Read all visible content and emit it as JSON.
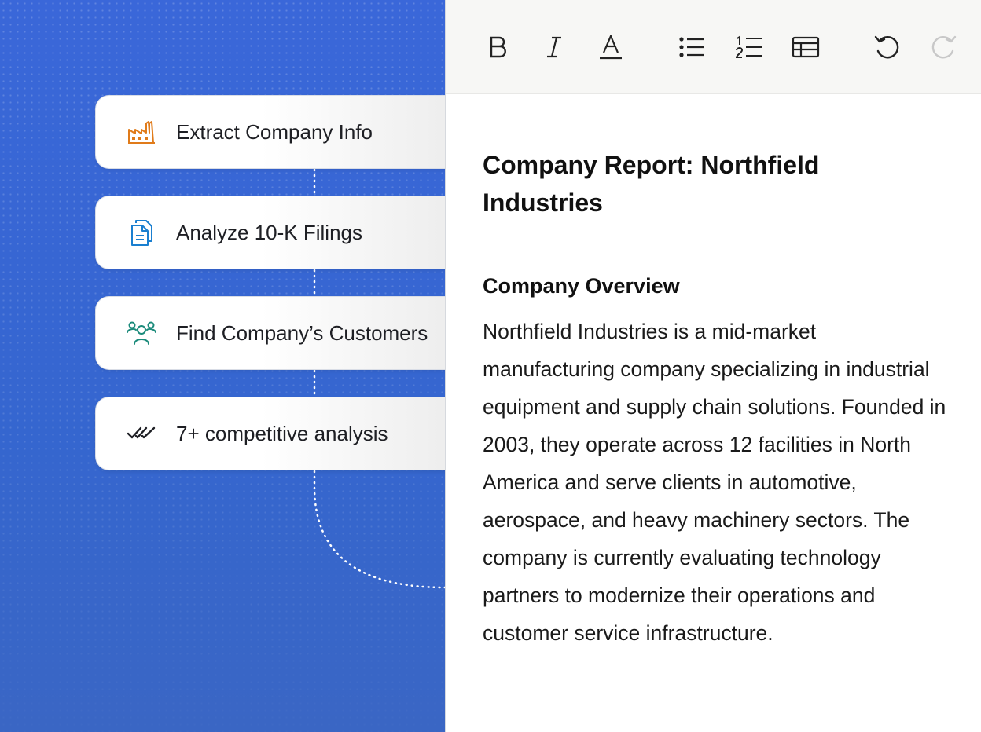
{
  "steps": [
    {
      "label": "Extract Company Info",
      "icon": "factory-icon",
      "color": "#e07b1a"
    },
    {
      "label": "Analyze 10-K Filings",
      "icon": "documents-icon",
      "color": "#1a7fd0"
    },
    {
      "label": "Find Company’s Customers",
      "icon": "people-icon",
      "color": "#1a8a7a"
    },
    {
      "label": "7+ competitive analysis",
      "icon": "double-check-icon",
      "color": "#1e1f24"
    }
  ],
  "toolbar": {
    "buttons": [
      {
        "name": "bold-button",
        "icon": "bold-icon"
      },
      {
        "name": "italic-button",
        "icon": "italic-icon"
      },
      {
        "name": "text-color-button",
        "icon": "text-color-icon"
      },
      {
        "name": "bullet-list-button",
        "icon": "bullet-list-icon"
      },
      {
        "name": "numbered-list-button",
        "icon": "numbered-list-icon"
      },
      {
        "name": "table-button",
        "icon": "table-icon"
      },
      {
        "name": "undo-button",
        "icon": "undo-icon"
      },
      {
        "name": "redo-button",
        "icon": "redo-icon",
        "disabled": true
      }
    ]
  },
  "document": {
    "title": "Company Report: Northfield Industries",
    "section_heading": "Company Overview",
    "body": "Northfield Industries is a mid-market manufacturing company specializing in industrial equipment and supply chain solutions. Founded in 2003, they operate across 12 facilities in North America and serve clients in automotive, aerospace, and heavy machinery sectors. The company is currently evaluating technology partners to modernize their operations and customer service infrastructure."
  },
  "colors": {
    "background_blue": "#3566cf",
    "toolbar_bg": "#f7f7f5",
    "disabled_icon": "#c8c8c8"
  }
}
